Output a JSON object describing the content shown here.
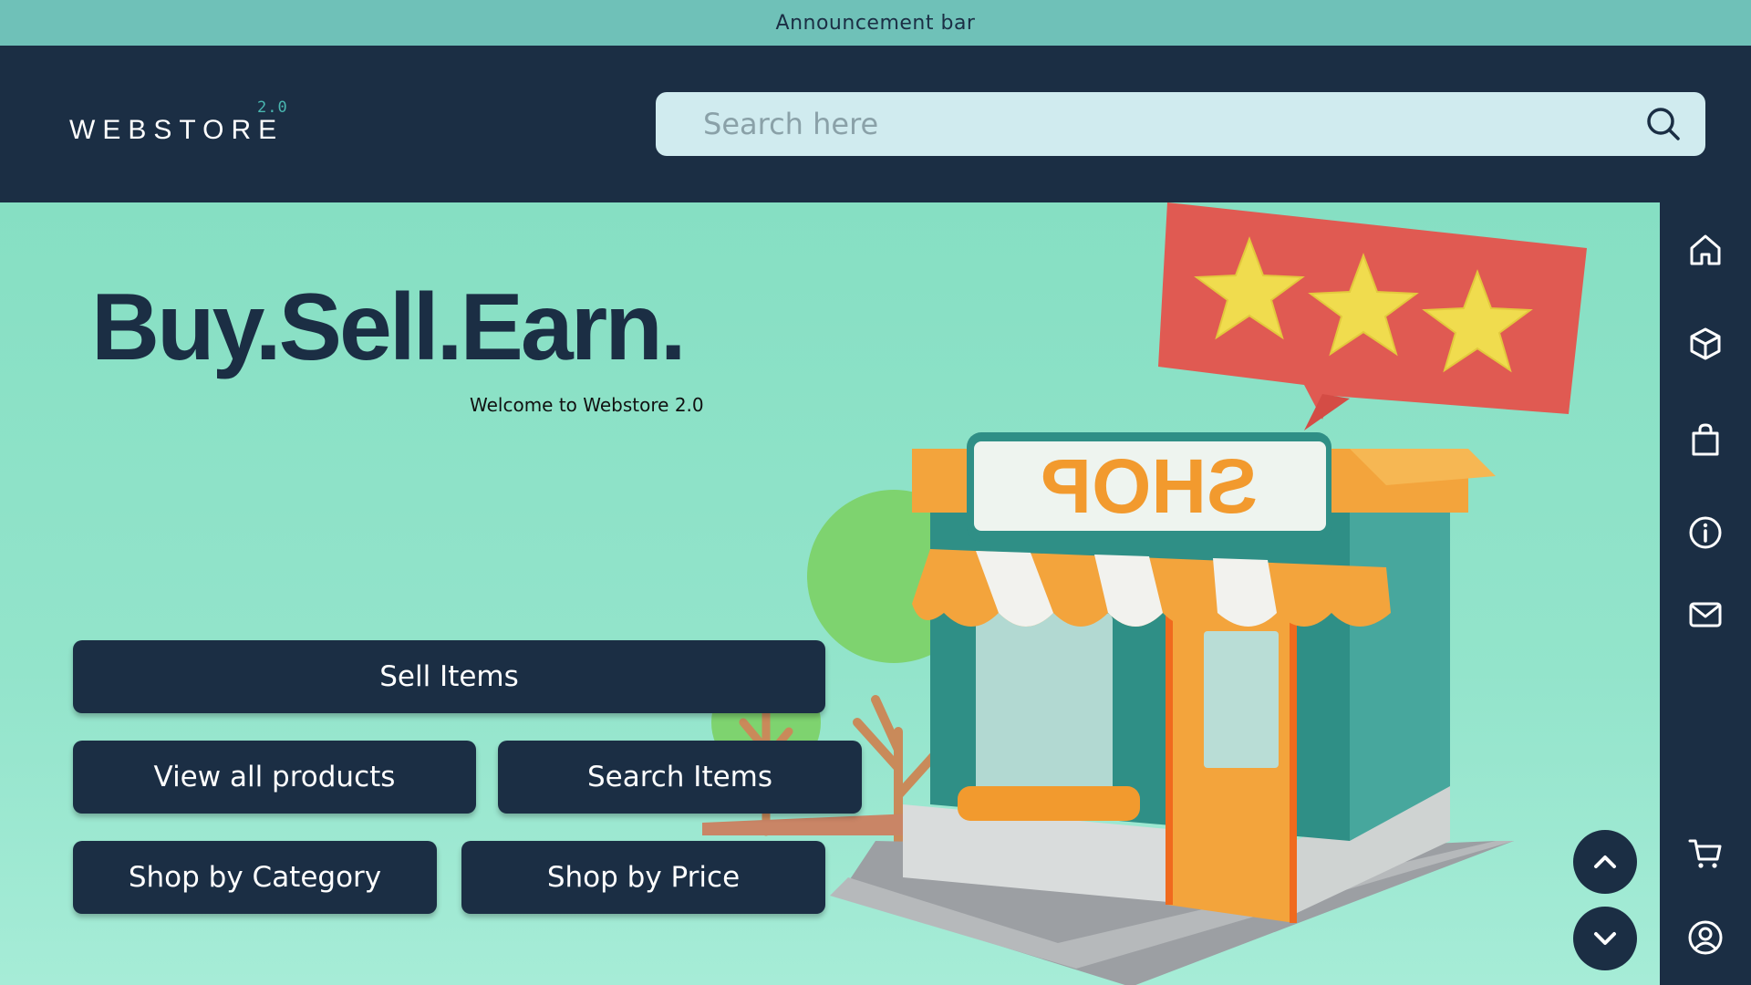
{
  "announcement": {
    "text": "Announcement bar"
  },
  "header": {
    "logo_text": "WEBSTORE",
    "logo_version": "2.0",
    "search": {
      "placeholder": "Search here",
      "value": ""
    }
  },
  "hero": {
    "headline": "Buy.Sell.Earn.",
    "subtitle": "Welcome to Webstore 2.0",
    "sign_text": "SHOP",
    "buttons": {
      "sell": "Sell Items",
      "view_all": "View all products",
      "search": "Search Items",
      "category": "Shop by Category",
      "price": "Shop by Price"
    }
  },
  "sidebar": {
    "icons": [
      "home-icon",
      "box-icon",
      "shopping-bag-icon",
      "info-icon",
      "mail-icon",
      "cart-icon",
      "user-circle-icon"
    ]
  },
  "scroll_controls": {
    "up": "chevron-up-icon",
    "down": "chevron-down-icon"
  },
  "colors": {
    "navy": "#1b2e44",
    "announcement_bg": "#6fc1b8",
    "hero_bg": "#8ce1c6",
    "search_bg": "#d0ebef",
    "accent_teal": "#49b6b0",
    "badge_red": "#e05a52",
    "star_yellow": "#f0dc4e",
    "awning_orange": "#f3a43c"
  }
}
